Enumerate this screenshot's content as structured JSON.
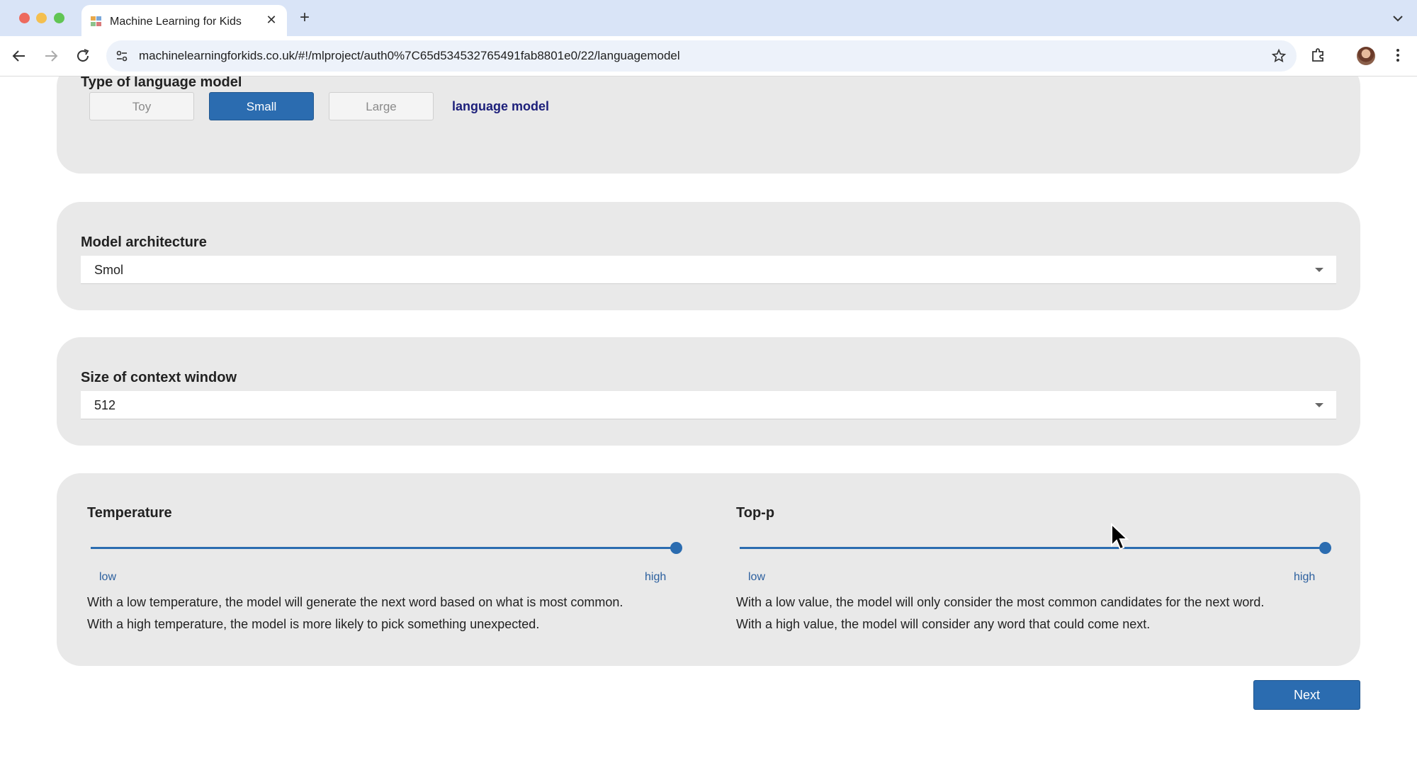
{
  "browser": {
    "tab_title": "Machine Learning for Kids",
    "url": "machinelearningforkids.co.uk/#!/mlproject/auth0%7C65d534532765491fab8801e0/22/languagemodel"
  },
  "model_type": {
    "title": "Type of language model",
    "options": [
      "Toy",
      "Small",
      "Large"
    ],
    "selected": "Small",
    "link_label": "language model"
  },
  "architecture": {
    "title": "Model architecture",
    "value": "Smol"
  },
  "context_window": {
    "title": "Size of context window",
    "value": "512"
  },
  "temperature": {
    "title": "Temperature",
    "low_label": "low",
    "high_label": "high",
    "level": 1.0,
    "description_line1": "With a low temperature, the model will generate the next word based on what is most common.",
    "description_line2": "With a high temperature, the model is more likely to pick something unexpected."
  },
  "top_p": {
    "title": "Top-p",
    "low_label": "low",
    "high_label": "high",
    "level": 1.0,
    "description_line1": "With a low value, the model will only consider the most common candidates for the next word.",
    "description_line2": "With a high value, the model will consider any word that could come next."
  },
  "next_label": "Next",
  "colors": {
    "accent": "#2b6cb0",
    "panel": "#e9e9e9",
    "link": "#1c1f7a"
  }
}
